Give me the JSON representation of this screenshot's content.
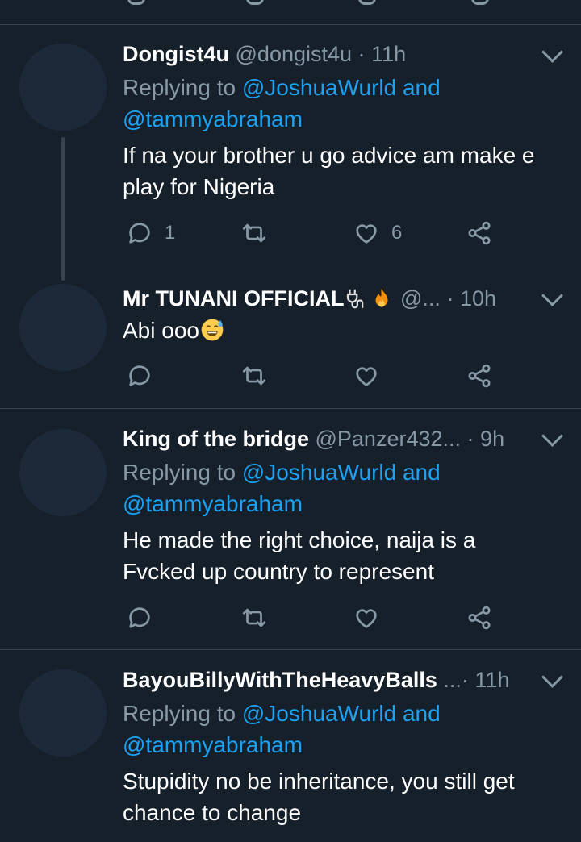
{
  "colors": {
    "background": "#15202b",
    "divider": "#38444d",
    "text": "#ffffff",
    "muted": "#8899a6",
    "link": "#1da1f2"
  },
  "icons": {
    "reply": "speech-bubble-icon",
    "retweet": "retweet-icon",
    "like": "heart-icon",
    "share": "share-icon",
    "more": "chevron-down-icon"
  },
  "tweets": [
    {
      "name": "Dongist4u",
      "handle": "@dongist4u",
      "separator": "·",
      "time": "11h",
      "replying_prefix": "Replying to ",
      "replying_mention1": "@JoshuaWurld and",
      "replying_mention2": "@tammyabraham",
      "text1": "If na your brother u go advice am make e",
      "text2": "play for Nigeria",
      "reply_count": "1",
      "retweet_count": "",
      "like_count": "6"
    },
    {
      "name": "Mr TUNANI OFFICIAL",
      "handle": "@...",
      "separator": "·",
      "time": "10h",
      "text1": "Abi ooo",
      "reply_count": "",
      "retweet_count": "",
      "like_count": ""
    },
    {
      "name": "King of the bridge",
      "handle": "@Panzer432...",
      "separator": "·",
      "time": "9h",
      "replying_prefix": "Replying to ",
      "replying_mention1": "@JoshuaWurld and",
      "replying_mention2": "@tammyabraham",
      "text1": "He made the right choice, naija is a",
      "text2": "Fvcked up country to represent",
      "reply_count": "",
      "retweet_count": "",
      "like_count": ""
    },
    {
      "name": "BayouBillyWithTheHeavyBalls",
      "handle": "...",
      "separator": "·",
      "time": "11h",
      "replying_prefix": "Replying to ",
      "replying_mention1": "@JoshuaWurld and",
      "replying_mention2": "@tammyabraham",
      "text1": "Stupidity no be inheritance, you still get",
      "text2": "chance to change"
    }
  ]
}
